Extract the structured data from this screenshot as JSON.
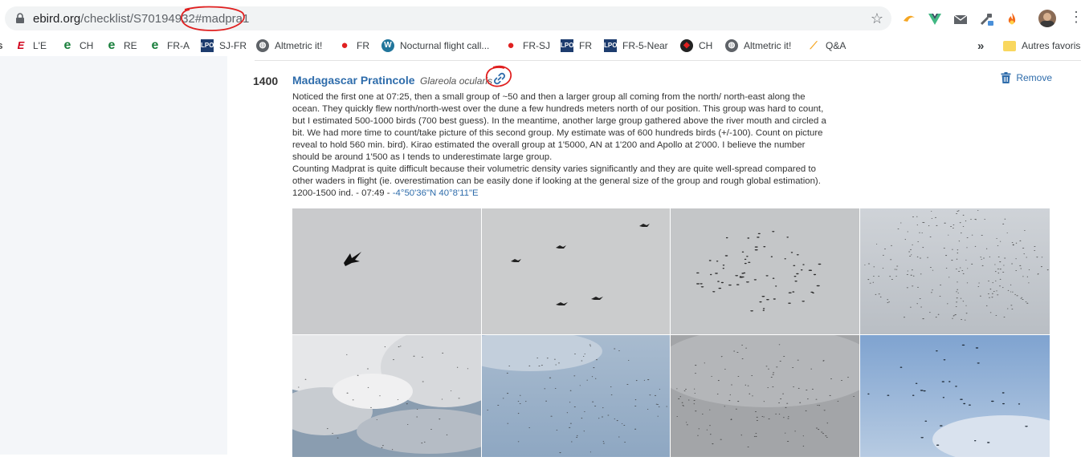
{
  "browser": {
    "url_host": "ebird.org",
    "url_path": "/checklist/S70194932",
    "url_hash": "#madpra1"
  },
  "bookmarks": [
    {
      "label": "",
      "icon": "partial-icon"
    },
    {
      "label": "L'E",
      "icon": "lexpress-icon"
    },
    {
      "label": "CH",
      "icon": "e-icon"
    },
    {
      "label": "RE",
      "icon": "e-icon"
    },
    {
      "label": "FR-A",
      "icon": "e-icon"
    },
    {
      "label": "SJ-FR",
      "icon": "lpo-icon"
    },
    {
      "label": "Altmetric it!",
      "icon": "globe-icon"
    },
    {
      "label": "FR",
      "icon": "pin-icon"
    },
    {
      "label": "Nocturnal flight call...",
      "icon": "wordpress-icon"
    },
    {
      "label": "FR-SJ",
      "icon": "pin-icon"
    },
    {
      "label": "FR",
      "icon": "lpo-icon"
    },
    {
      "label": "FR-5-Near",
      "icon": "lpo-icon"
    },
    {
      "label": "CH",
      "icon": "bird-icon"
    },
    {
      "label": "Altmetric it!",
      "icon": "globe-icon"
    },
    {
      "label": "Q&A",
      "icon": "qa-icon"
    }
  ],
  "overflow_label": "»",
  "other_favorites": "Autres favoris",
  "observation": {
    "count": "1400",
    "common_name": "Madagascar Pratincole",
    "scientific_name": "Glareola ocularis",
    "remove_label": "Remove",
    "comment_lines": [
      "Noticed the first one at 07:25, then a small group of ~50 and then a larger group all coming from the north/ north-east along the",
      "ocean. They quickly flew north/north-west over the dune a few hundreds meters north of our position. This group was hard to count,",
      "but I estimated 500-1000 birds (700 best guess). In the meantime, another large group gathered above the river mouth and circled a",
      "bit. We had more time to count/take picture of this second group. My estimate was of 600 hundreds birds (+/-100). Count on picture",
      "reveal to hold 560 min. bird). Kirao estimated the overall group at 1'5000, AN at 1'200 and Apollo at 2'000. I believe the number",
      "should be around 1'500 as I tends to underestimate large group.",
      "Counting Madprat is quite difficult because their volumetric density varies significantly and they are quite well-spread compared to",
      "other waders in flight (ie. overestimation can be easily done if looking at the general size of the group and rough global estimation)."
    ],
    "detail_prefix": "1200-1500 ind. - 07:49 - ",
    "coordinates": "-4°50'36\"N 40°8'11\"E"
  },
  "colors": {
    "link": "#2e6cab",
    "annotation": "#e02020",
    "sidebar": "#f4f6f9"
  }
}
